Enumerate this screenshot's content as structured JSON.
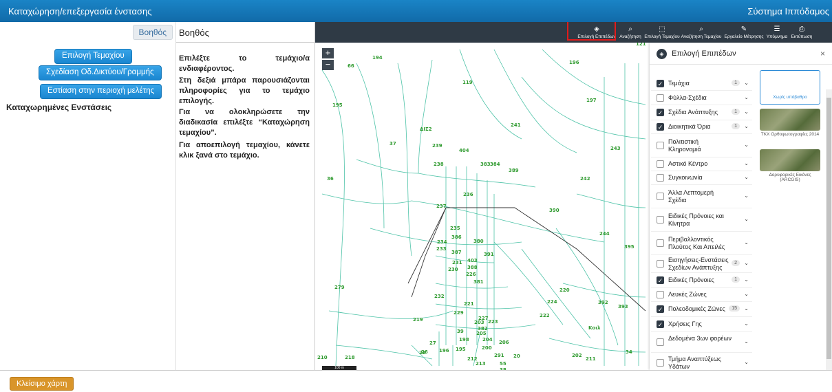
{
  "header": {
    "title": "Καταχώρηση/επεξεργασία ένστασης",
    "system": "Σύστημα Ιππόδαμος"
  },
  "left_panel": {
    "help_button": "Βοηθός",
    "buttons": [
      "Επιλογή Τεμαχίου",
      "Σχεδίαση Οδ.Δικτύου/Γραμμής",
      "Εστίαση στην περιοχή μελέτης"
    ],
    "registered_title": "Καταχωρημένες Ενστάσεις"
  },
  "help_panel": {
    "title": "Βοηθός",
    "paragraphs": [
      "Επιλέξτε το τεμάχιο/α ενδιαφέροντος.",
      "Στη δεξιά μπάρα παρουσιάζονται πληροφορίες για το τεμάχιο επιλογής.",
      "Για να ολοκληρώσετε την διαδικασία επιλέξτε “Καταχώρηση τεμαχίου”.",
      "Για αποεπιλογή τεμαχίου, κάνετε κλικ ξανά στο τεμάχιο."
    ]
  },
  "toolbar": {
    "items": [
      {
        "label": "Επιλογή Επιπέδων",
        "icon": "layers-icon",
        "glyph": "◈"
      },
      {
        "label": "Αναζήτηση",
        "icon": "search-icon",
        "glyph": "⌕"
      },
      {
        "label": "Επιλογή Τεμαχίου",
        "icon": "select-parcel-icon",
        "glyph": "⬚"
      },
      {
        "label": "Αναζήτηση Τεμαχίου",
        "icon": "search-parcel-icon",
        "glyph": "⌕"
      },
      {
        "label": "Εργαλείο Μέτρησης",
        "icon": "ruler-icon",
        "glyph": "✎"
      },
      {
        "label": "Υπόμνημα",
        "icon": "legend-icon",
        "glyph": "☰"
      },
      {
        "label": "Εκτύπωση",
        "icon": "print-icon",
        "glyph": "⎙"
      }
    ]
  },
  "map": {
    "zoom_in": "+",
    "zoom_out": "−",
    "scale": "100 m",
    "labels": [
      "115",
      "116",
      "121",
      "194",
      "66",
      "196",
      "119",
      "197",
      "195",
      "241",
      "ΔΙΣ2",
      "37",
      "239",
      "404",
      "243",
      "383",
      "384",
      "389",
      "238",
      "36",
      "242",
      "236",
      "237",
      "390",
      "235",
      "386",
      "234",
      "380",
      "233",
      "387",
      "391",
      "403",
      "231",
      "388",
      "395",
      "244",
      "230",
      "226",
      "279",
      "232",
      "220",
      "381",
      "224",
      "221",
      "392",
      "393",
      "229",
      "227",
      "382",
      "223",
      "222",
      "Κοιλ",
      "219",
      "39",
      "203",
      "205",
      "27",
      "198",
      "204",
      "206",
      "26",
      "28",
      "196",
      "195",
      "200",
      "202",
      "34",
      "218",
      "212",
      "291",
      "20",
      "211",
      "210",
      "213",
      "55",
      "38",
      "40",
      "32"
    ],
    "line_color": "#4ec3a8",
    "label_color": "#2e9a2e"
  },
  "layers_panel": {
    "title": "Επιλογή Επιπέδων",
    "close": "×",
    "layers": [
      {
        "name": "Τεμάχια",
        "checked": true,
        "count": "1"
      },
      {
        "name": "Φύλλα-Σχέδια",
        "checked": false,
        "count": ""
      },
      {
        "name": "Σχέδια Ανάπτυξης",
        "checked": true,
        "count": "1"
      },
      {
        "name": "Διοικητικά Όρια",
        "checked": true,
        "count": "1"
      },
      {
        "name": "Πολιτιστική Κληρονομιά",
        "checked": false,
        "count": ""
      },
      {
        "name": "Αστικό Κέντρο",
        "checked": false,
        "count": ""
      },
      {
        "name": "Συγκοινωνία",
        "checked": false,
        "count": ""
      },
      {
        "name": "Άλλα Λεπτομερή Σχέδια",
        "checked": false,
        "count": ""
      },
      {
        "name": "Ειδικές Πρόνοιες και Κίνητρα",
        "checked": false,
        "count": ""
      },
      {
        "name": "Περιβαλλοντικός Πλούτος Και Απειλές",
        "checked": false,
        "count": ""
      },
      {
        "name": "Εισηγήσεις-Ενστάσεις Σχεδίων Ανάπτυξης",
        "checked": false,
        "count": "2"
      },
      {
        "name": "Ειδικές Πρόνοιες",
        "checked": true,
        "count": "1"
      },
      {
        "name": "Λευκές Ζώνες",
        "checked": false,
        "count": ""
      },
      {
        "name": "Πολεοδομικές Ζώνες",
        "checked": true,
        "count": "15"
      },
      {
        "name": "Χρήσεις Γης",
        "checked": true,
        "count": ""
      },
      {
        "name": "Δεδομένα 3ων φορέων",
        "checked": false,
        "count": ""
      },
      {
        "name": "Τμήμα Αναπτύξεως Υδάτων",
        "checked": false,
        "count": ""
      }
    ],
    "basemaps": [
      {
        "name": "Χωρίς υπόβαθρο",
        "selected": true
      },
      {
        "name": "ΤΚΧ Ορθοφωτογραφίες 2014",
        "selected": false
      },
      {
        "name": "Δορυφορικές Εικόνες (ARCGIS)",
        "selected": false
      }
    ]
  },
  "footer": {
    "close_map": "Κλείσιμο χάρτη"
  }
}
